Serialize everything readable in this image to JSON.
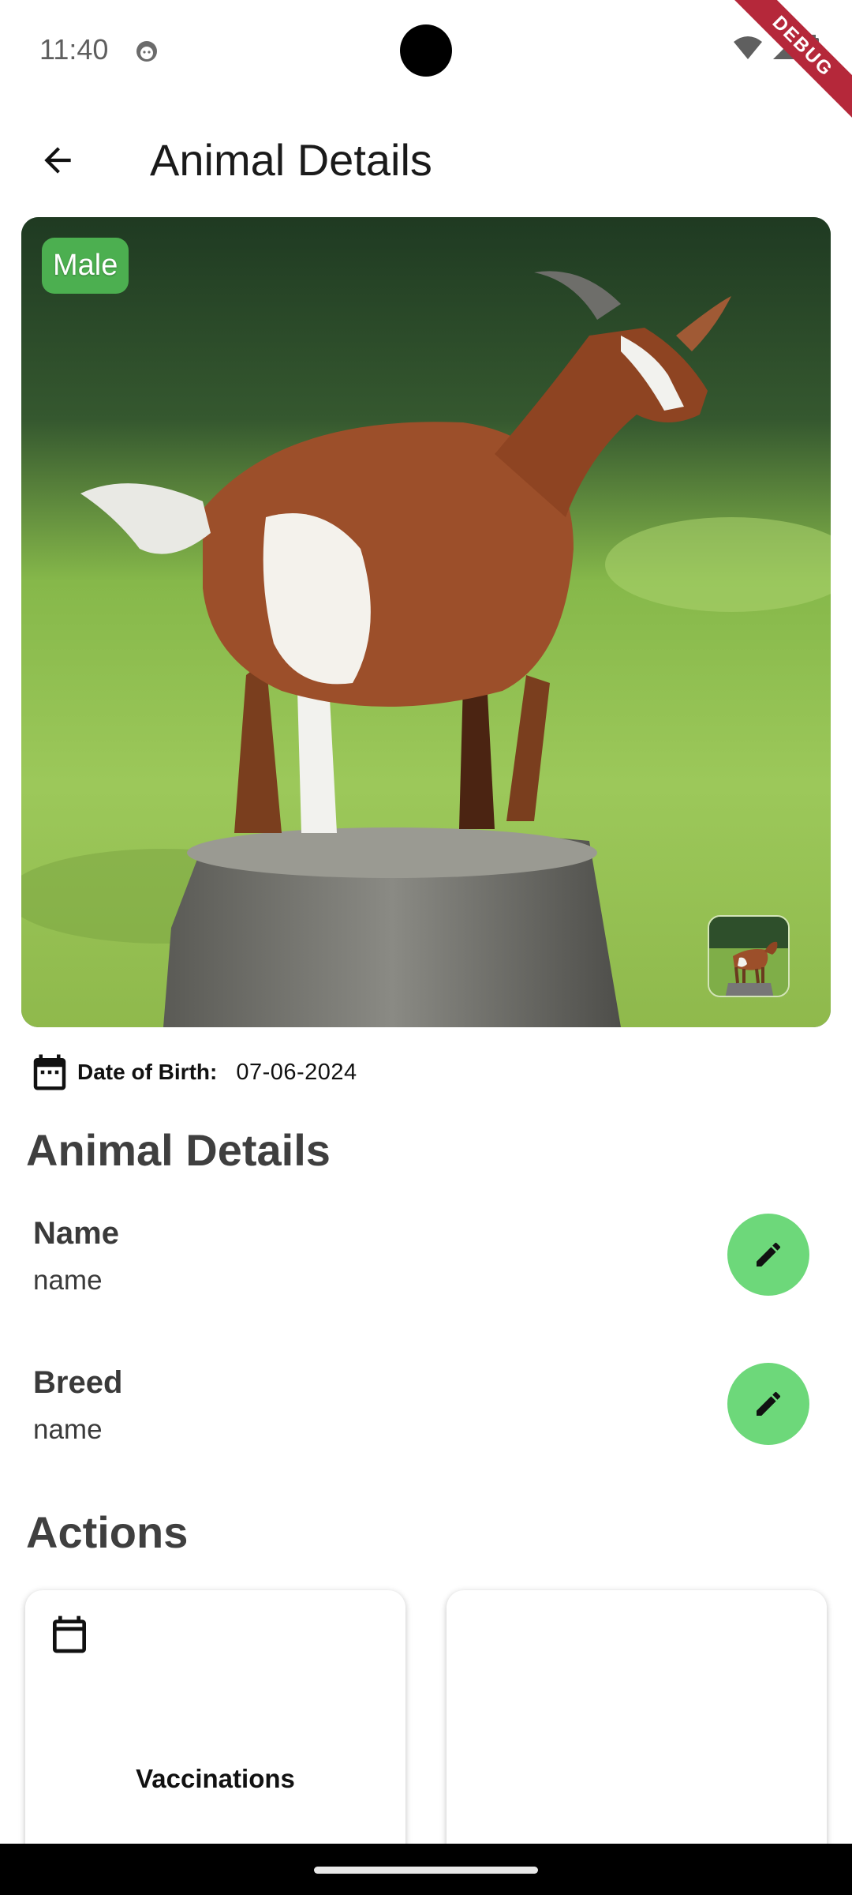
{
  "status_bar": {
    "time": "11:40",
    "debug_label": "DEBUG"
  },
  "app_bar": {
    "title": "Animal Details",
    "back_icon": "arrow-left-icon"
  },
  "hero": {
    "gender_badge": "Male",
    "badge_color": "#4caf50"
  },
  "dob": {
    "label": "Date of Birth:",
    "value": "07-06-2024",
    "icon": "calendar-icon"
  },
  "details_section": {
    "title": "Animal Details",
    "rows": [
      {
        "label": "Name",
        "value": "name",
        "edit_icon": "pencil-icon"
      },
      {
        "label": "Breed",
        "value": "name",
        "edit_icon": "pencil-icon"
      }
    ]
  },
  "actions_section": {
    "title": "Actions",
    "cards": [
      {
        "label": "Vaccinations",
        "icon": "calendar-icon"
      },
      {
        "label": "",
        "icon": ""
      }
    ]
  },
  "colors": {
    "accent": "#6dd87a",
    "badge": "#4caf50",
    "debug": "#b5283a"
  }
}
